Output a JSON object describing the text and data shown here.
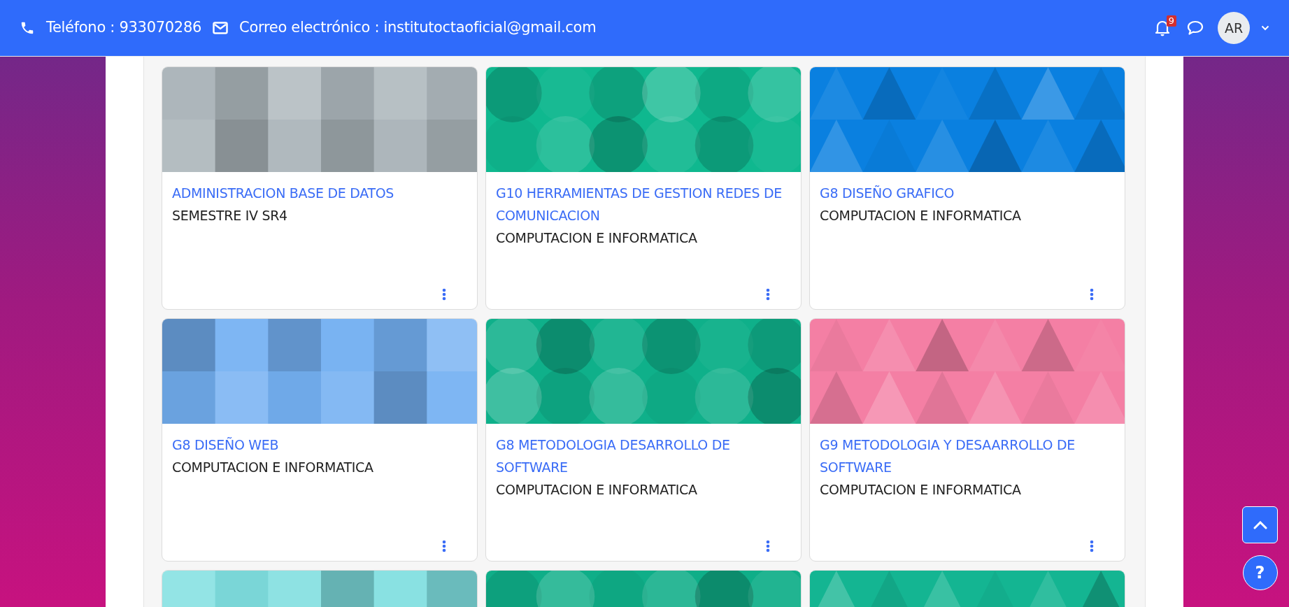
{
  "header": {
    "phone_label": "Teléfono : 933070286",
    "email_label": "Correo electrónico : institutoctaoficial@gmail.com",
    "notification_count": "9",
    "avatar_initials": "AR"
  },
  "help_button": "?",
  "courses": [
    {
      "kind": "course",
      "title": "ADMINISTRACION BASE DE DATOS",
      "category": "SEMESTRE IV SR4",
      "color": "#aab4b9"
    },
    {
      "kind": "course",
      "title": "G10 HERRAMIENTAS DE GESTION REDES DE COMUNICACION",
      "category": "COMPUTACION E INFORMATICA",
      "color": "#0fb88f"
    },
    {
      "kind": "course",
      "title": "G8 DISEÑO GRAFICO",
      "category": "COMPUTACION E INFORMATICA",
      "color": "#0a80e0"
    },
    {
      "kind": "course",
      "title": "G8 DISEÑO WEB",
      "category": "COMPUTACION E INFORMATICA",
      "color": "#74b0f2"
    },
    {
      "kind": "course",
      "title": "G8 METODOLOGIA DESARROLLO DE SOFTWARE",
      "category": "COMPUTACION E INFORMATICA",
      "color": "#0fb08a"
    },
    {
      "kind": "course",
      "title": "G9 METODOLOGIA Y DESAARROLLO DE SOFTWARE",
      "category": "COMPUTACION E INFORMATICA",
      "color": "#f47fa4"
    },
    {
      "kind": "cut",
      "color": "#7fdfe0"
    },
    {
      "kind": "cut",
      "color": "#0fae88"
    },
    {
      "kind": "cut",
      "color": "#14b592"
    }
  ]
}
